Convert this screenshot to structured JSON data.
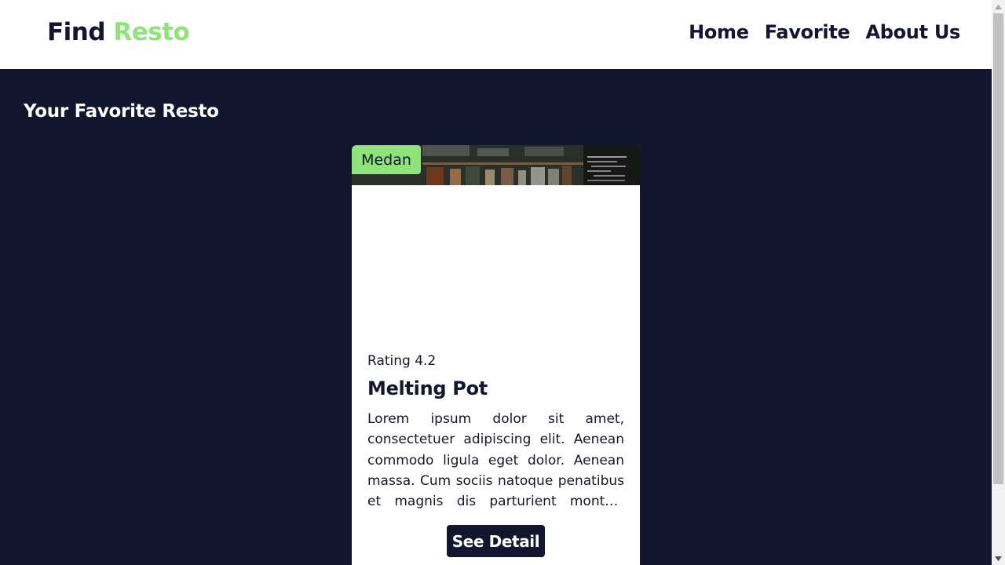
{
  "header": {
    "brand_part1": "Find",
    "brand_part2": "Resto",
    "nav": [
      {
        "label": "Home"
      },
      {
        "label": "Favorite"
      },
      {
        "label": "About Us"
      }
    ]
  },
  "main": {
    "section_title": "Your Favorite Resto",
    "cards": [
      {
        "city": "Medan",
        "rating": "Rating 4.2",
        "name": "Melting Pot",
        "description": "Lorem ipsum dolor sit amet, consectetuer adipiscing elit. Aenean commodo ligula eget dolor. Aenean massa. Cum sociis natoque penatibus et magnis dis parturient montes, nascetur ridiculus mus.",
        "button_label": "See Detail"
      }
    ]
  },
  "colors": {
    "primary_dark": "#12162e",
    "accent_green": "#8fe37b",
    "surface": "#ffffff"
  },
  "icons": {
    "scroll_up": "scroll-up-arrow-icon",
    "scroll_down": "scroll-down-arrow-icon"
  }
}
